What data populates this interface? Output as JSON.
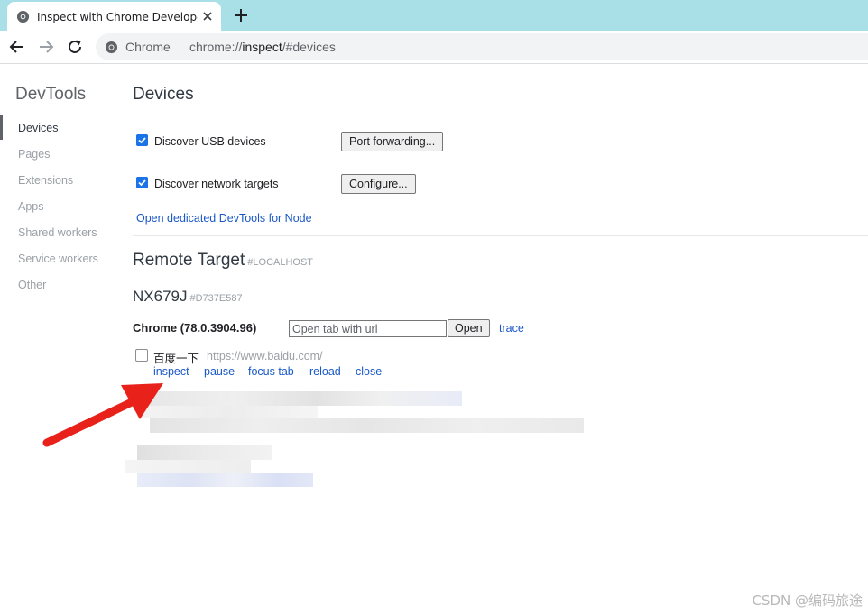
{
  "browser": {
    "tab_title": "Inspect with Chrome Developer Tools",
    "omnibox": {
      "chip": "Chrome",
      "url_scheme": "chrome://",
      "url_host": "inspect",
      "url_rest": "/#devices"
    }
  },
  "sidebar": {
    "title": "DevTools",
    "items": [
      {
        "label": "Devices",
        "active": true
      },
      {
        "label": "Pages"
      },
      {
        "label": "Extensions"
      },
      {
        "label": "Apps"
      },
      {
        "label": "Shared workers"
      },
      {
        "label": "Service workers"
      },
      {
        "label": "Other"
      }
    ]
  },
  "devices": {
    "title": "Devices",
    "usb": {
      "label": "Discover USB devices",
      "checked": true,
      "button": "Port forwarding..."
    },
    "network": {
      "label": "Discover network targets",
      "checked": true,
      "button": "Configure..."
    },
    "node_link": "Open dedicated DevTools for Node"
  },
  "remote": {
    "title": "Remote Target",
    "subtitle": "#LOCALHOST",
    "device_name": "NX679J",
    "device_id": "#D737E587",
    "browser_name": "Chrome (78.0.3904.96)",
    "url_placeholder": "Open tab with url",
    "open_button": "Open",
    "trace_link": "trace",
    "page": {
      "title": "百度一下",
      "url": "https://www.baidu.com/",
      "actions": [
        "inspect",
        "pause",
        "focus tab",
        "reload",
        "close"
      ]
    }
  },
  "watermark": "CSDN @编码旅途",
  "colors": {
    "tabstrip": "#a9dfe6",
    "link": "#1a58c8",
    "checkbox": "#1a73e8",
    "arrow": "#e8221b"
  }
}
